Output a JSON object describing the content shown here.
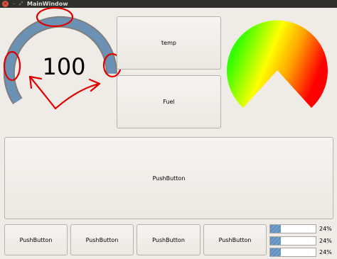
{
  "window": {
    "title": "MainWindow",
    "controls": {
      "close": "×",
      "minimize": "–",
      "maximize": "⤢"
    }
  },
  "gauge": {
    "value": "100",
    "arc_color": "#6b92b4",
    "arc_border_color": "#808080",
    "annotation_color": "#e00000"
  },
  "buttons": {
    "temp": "temp",
    "fuel": "Fuel",
    "big": "PushButton",
    "bottom": [
      "PushButton",
      "PushButton",
      "PushButton",
      "PushButton"
    ]
  },
  "color_gauge": {
    "colors": [
      "#00ff00",
      "#ffff00",
      "#ff0000"
    ]
  },
  "progress": [
    {
      "value": 0.24,
      "text": "24%"
    },
    {
      "value": 0.24,
      "text": "24%"
    },
    {
      "value": 0.24,
      "text": "24%"
    }
  ]
}
